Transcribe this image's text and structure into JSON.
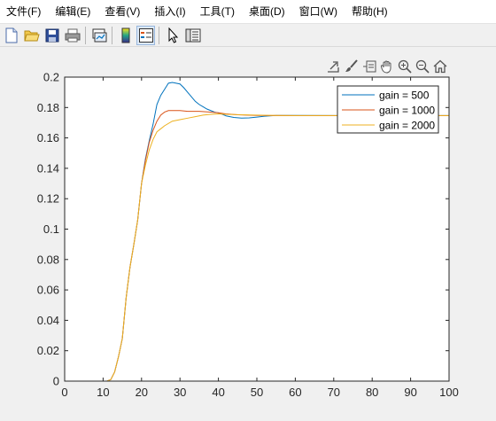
{
  "menubar": {
    "items": [
      {
        "label": "文件(F)"
      },
      {
        "label": "编辑(E)"
      },
      {
        "label": "查看(V)"
      },
      {
        "label": "插入(I)"
      },
      {
        "label": "工具(T)"
      },
      {
        "label": "桌面(D)"
      },
      {
        "label": "窗口(W)"
      },
      {
        "label": "帮助(H)"
      }
    ]
  },
  "toolbar": {
    "buttons": [
      {
        "icon": "new-file-icon"
      },
      {
        "icon": "open-folder-icon"
      },
      {
        "icon": "save-icon"
      },
      {
        "icon": "print-icon"
      },
      {
        "icon": "link-plot-icon"
      },
      {
        "icon": "colorbar-icon"
      },
      {
        "icon": "legend-icon"
      },
      {
        "icon": "pointer-icon"
      },
      {
        "icon": "property-editor-icon"
      }
    ]
  },
  "axes_toolbar": {
    "buttons": [
      {
        "icon": "export-icon"
      },
      {
        "icon": "brush-icon"
      },
      {
        "icon": "data-tips-icon"
      },
      {
        "icon": "pan-icon"
      },
      {
        "icon": "zoom-in-icon"
      },
      {
        "icon": "zoom-out-icon"
      },
      {
        "icon": "home-icon"
      }
    ]
  },
  "chart_data": {
    "type": "line",
    "title": "",
    "xlabel": "",
    "ylabel": "",
    "xlim": [
      0,
      100
    ],
    "ylim": [
      0,
      0.2
    ],
    "xticks": [
      "0",
      "10",
      "20",
      "30",
      "40",
      "50",
      "60",
      "70",
      "80",
      "90",
      "100"
    ],
    "yticks": [
      "0",
      "0.02",
      "0.04",
      "0.06",
      "0.08",
      "0.1",
      "0.12",
      "0.14",
      "0.16",
      "0.18",
      "0.2"
    ],
    "grid": false,
    "legend_position": "top-right",
    "series": [
      {
        "name": "gain = 500",
        "color": "#0072bd",
        "x": [
          0,
          11,
          12,
          13,
          14,
          15,
          16,
          17,
          18,
          19,
          20,
          21,
          22,
          23,
          24,
          25,
          26,
          27,
          28,
          29,
          30,
          31,
          32,
          33,
          34,
          35,
          36,
          37,
          38,
          39,
          40,
          42,
          44,
          46,
          48,
          50,
          52,
          55,
          60,
          70,
          80,
          90,
          100
        ],
        "y": [
          0,
          0,
          0.001,
          0.006,
          0.016,
          0.028,
          0.055,
          0.075,
          0.09,
          0.106,
          0.13,
          0.146,
          0.158,
          0.169,
          0.182,
          0.188,
          0.192,
          0.196,
          0.1965,
          0.196,
          0.1955,
          0.193,
          0.19,
          0.187,
          0.184,
          0.182,
          0.1805,
          0.179,
          0.178,
          0.177,
          0.1765,
          0.1745,
          0.1735,
          0.173,
          0.1732,
          0.1737,
          0.1743,
          0.1748,
          0.1748,
          0.1747,
          0.1747,
          0.1747,
          0.1747
        ]
      },
      {
        "name": "gain = 1000",
        "color": "#d95319",
        "x": [
          0,
          11,
          12,
          13,
          14,
          15,
          16,
          17,
          18,
          19,
          20,
          21,
          22,
          23,
          24,
          25,
          26,
          27,
          28,
          30,
          32,
          35,
          38,
          40,
          42,
          45,
          50,
          55,
          60,
          70,
          80,
          90,
          100
        ],
        "y": [
          0,
          0,
          0.001,
          0.006,
          0.016,
          0.028,
          0.055,
          0.075,
          0.09,
          0.106,
          0.13,
          0.145,
          0.157,
          0.165,
          0.171,
          0.175,
          0.177,
          0.178,
          0.178,
          0.178,
          0.1775,
          0.1775,
          0.177,
          0.1765,
          0.1758,
          0.1752,
          0.1748,
          0.1747,
          0.1746,
          0.1746,
          0.1746,
          0.1746,
          0.1746
        ]
      },
      {
        "name": "gain = 2000",
        "color": "#edb120",
        "x": [
          0,
          11,
          12,
          13,
          14,
          15,
          16,
          17,
          18,
          19,
          20,
          21,
          22,
          23,
          24,
          25,
          26,
          28,
          30,
          32,
          34,
          36,
          38,
          40,
          42,
          45,
          50,
          55,
          60,
          70,
          80,
          90,
          100
        ],
        "y": [
          0,
          0,
          0.001,
          0.006,
          0.016,
          0.028,
          0.055,
          0.075,
          0.09,
          0.106,
          0.13,
          0.142,
          0.152,
          0.159,
          0.164,
          0.166,
          0.168,
          0.171,
          0.172,
          0.173,
          0.174,
          0.175,
          0.1755,
          0.1758,
          0.1755,
          0.1753,
          0.175,
          0.1748,
          0.1747,
          0.1747,
          0.1747,
          0.1747,
          0.1747
        ]
      }
    ]
  }
}
